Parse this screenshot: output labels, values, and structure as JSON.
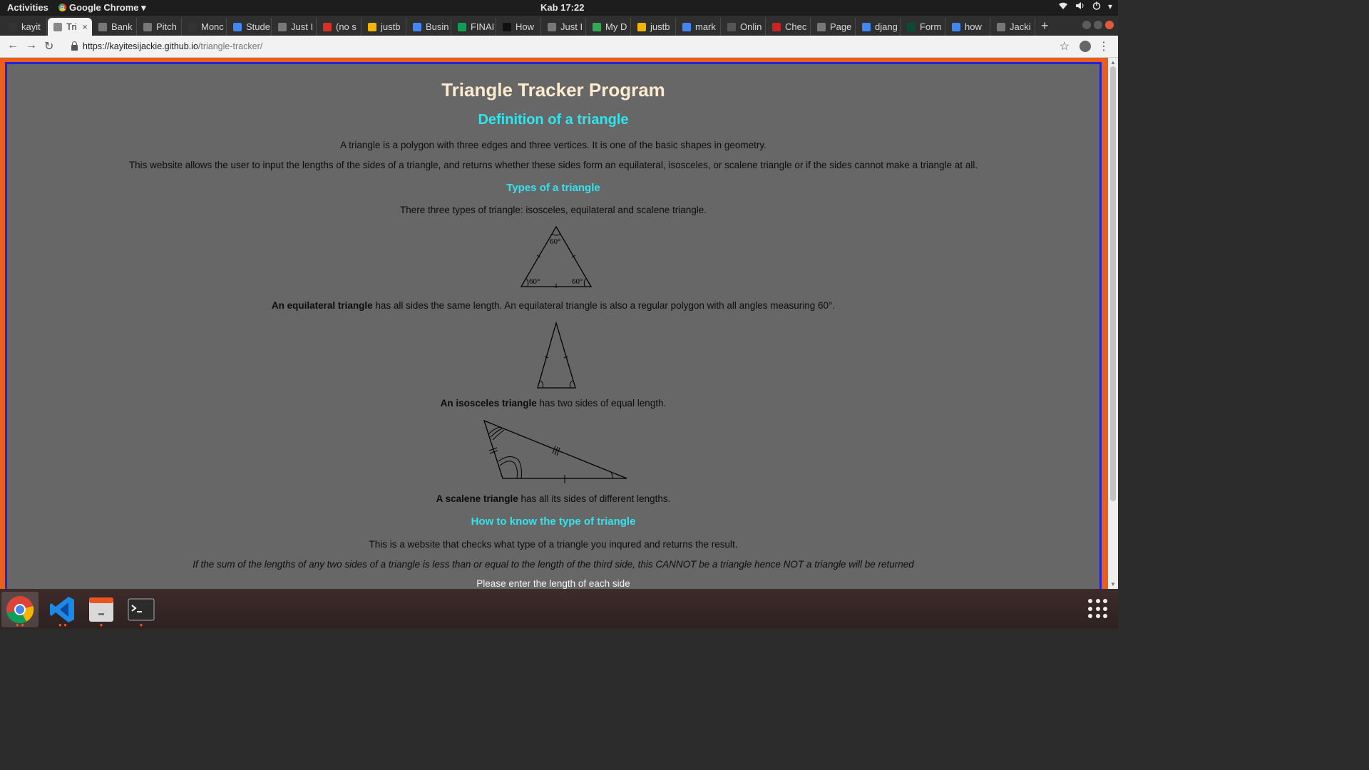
{
  "system": {
    "activities": "Activities",
    "app_menu": "Google Chrome",
    "clock": "Kab 17:22"
  },
  "tabs": [
    {
      "label": "kayit",
      "icon": "github-icon",
      "color": "#333333"
    },
    {
      "label": "Tri",
      "icon": "page-icon",
      "color": "#888888",
      "active": true
    },
    {
      "label": "Bank",
      "icon": "page-icon",
      "color": "#777777"
    },
    {
      "label": "Pitch",
      "icon": "page-icon",
      "color": "#777777"
    },
    {
      "label": "Monc",
      "icon": "github-icon",
      "color": "#333333"
    },
    {
      "label": "Stude",
      "icon": "google-docs-icon",
      "color": "#4285f4"
    },
    {
      "label": "Just I",
      "icon": "page-icon",
      "color": "#777777"
    },
    {
      "label": "(no s",
      "icon": "gmail-icon",
      "color": "#d93025"
    },
    {
      "label": "justb",
      "icon": "google-slides-icon",
      "color": "#f4b400"
    },
    {
      "label": "Busin",
      "icon": "google-docs-icon",
      "color": "#4285f4"
    },
    {
      "label": "FINAI",
      "icon": "google-sheets-icon",
      "color": "#0f9d58"
    },
    {
      "label": "How",
      "icon": "htg-icon",
      "color": "#111111"
    },
    {
      "label": "Just I",
      "icon": "page-icon",
      "color": "#777777"
    },
    {
      "label": "My D",
      "icon": "google-drive-icon",
      "color": "#34a853"
    },
    {
      "label": "justb",
      "icon": "google-slides-icon",
      "color": "#f4b400"
    },
    {
      "label": "mark",
      "icon": "google-icon",
      "color": "#4285f4"
    },
    {
      "label": "Onlin",
      "icon": "calendar-icon",
      "color": "#555555"
    },
    {
      "label": "Chec",
      "icon": "red-tool-icon",
      "color": "#cc2222"
    },
    {
      "label": "Page",
      "icon": "page-icon",
      "color": "#777777"
    },
    {
      "label": "djang",
      "icon": "google-icon",
      "color": "#4285f4"
    },
    {
      "label": "Form",
      "icon": "django-icon",
      "color": "#0c4b33"
    },
    {
      "label": "how",
      "icon": "google-icon",
      "color": "#4285f4"
    },
    {
      "label": "Jacki",
      "icon": "page-icon",
      "color": "#777777"
    }
  ],
  "address_bar": {
    "host": "https://kayitesijackie.github.io",
    "path": "/triangle-tracker/"
  },
  "page": {
    "title": "Triangle Tracker Program",
    "definition_heading": "Definition of a triangle",
    "definition_text": "A triangle is a polygon with three edges and three vertices. It is one of the basic shapes in geometry.",
    "description_text": "This website allows the user to input the lengths of the sides of a triangle, and returns whether these sides form an equilateral, isosceles, or scalene triangle or if the sides cannot make a triangle at all.",
    "types_heading": "Types of a triangle",
    "types_intro": "There three types of triangle: isosceles, equilateral and scalene triangle.",
    "equilateral": {
      "bold": "An equilateral triangle",
      "text": " has all sides the same length. An equilateral triangle is also a regular polygon with all angles measuring 60°.",
      "angle_label": "60°"
    },
    "isosceles": {
      "bold": "An isosceles triangle",
      "text": " has two sides of equal length."
    },
    "scalene": {
      "bold": "A scalene triangle",
      "text": " has all its sides of different lengths."
    },
    "how_heading": "How to know the type of triangle",
    "how_text": "This is a website that checks what type of a triangle you inqured and returns the result.",
    "rule_text": "If the sum of the lengths of any two sides of a triangle is less than or equal to the length of the third side, this CANNOT be a triangle hence NOT a triangle will be returned",
    "prompt": "Please enter the length of each side"
  },
  "colors": {
    "heading": "#33e3ee",
    "title": "#fdebd0",
    "page_bg": "#676767",
    "frame_border": "#2222dd",
    "frame_outer": "#e85f1c"
  },
  "dock": [
    "chrome-icon",
    "vscode-icon",
    "files-icon",
    "terminal-icon"
  ]
}
